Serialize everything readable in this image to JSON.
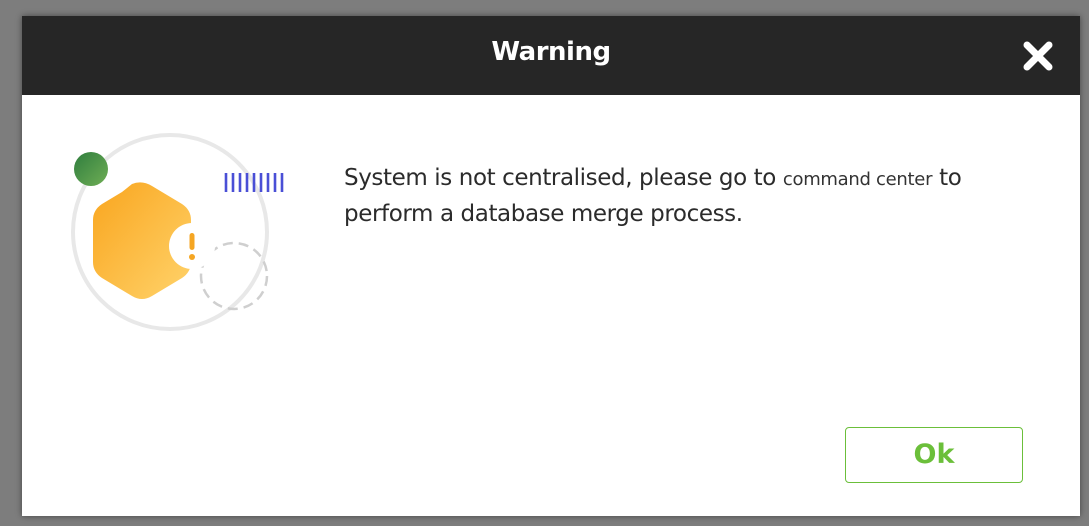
{
  "dialog": {
    "title": "Warning",
    "message_before": "System is not centralised, please go to ",
    "message_link": "command center",
    "message_after": " to perform a database merge process.",
    "ok_label": "Ok"
  },
  "icons": {
    "close": "close-icon",
    "warning": "warning-hexagon-icon"
  },
  "colors": {
    "titlebar": "#262626",
    "ok_accent": "#6bbf3a",
    "warning_orange": "#f5a623",
    "dot_green": "#3f8f4a",
    "stripes_blue": "#4a4fd6"
  }
}
